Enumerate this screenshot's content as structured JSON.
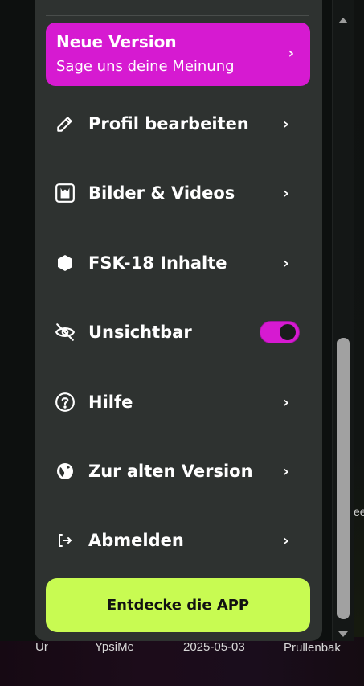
{
  "promo": {
    "title": "Neue Version",
    "subtitle": "Sage uns deine Meinung",
    "chevron": "›",
    "color": "#d61ad1"
  },
  "menu": {
    "items": [
      {
        "icon": "pencil-icon",
        "label": "Profil bearbeiten",
        "control": "chevron"
      },
      {
        "icon": "media-icon",
        "label": "Bilder & Videos",
        "control": "chevron"
      },
      {
        "icon": "hexagon-icon",
        "label": "FSK-18 Inhalte",
        "control": "chevron"
      },
      {
        "icon": "eye-off-icon",
        "label": "Unsichtbar",
        "control": "toggle",
        "toggle_on": true
      },
      {
        "icon": "help-icon",
        "label": "Hilfe",
        "control": "chevron"
      },
      {
        "icon": "globe-icon",
        "label": "Zur alten Version",
        "control": "chevron"
      },
      {
        "icon": "logout-icon",
        "label": "Abmelden",
        "control": "chevron"
      }
    ],
    "chevron": "›"
  },
  "cta": {
    "label": "Entdecke die APP",
    "color": "#c8fb52"
  },
  "desktop": {
    "labels": [
      "YpsiMe",
      "2025-05-03",
      "Prullenbak"
    ],
    "partial_left": "Ur",
    "partial_right": "ee"
  },
  "scrollbar": {
    "up_icon": "arrow-up-icon",
    "down_icon": "arrow-down-icon"
  }
}
